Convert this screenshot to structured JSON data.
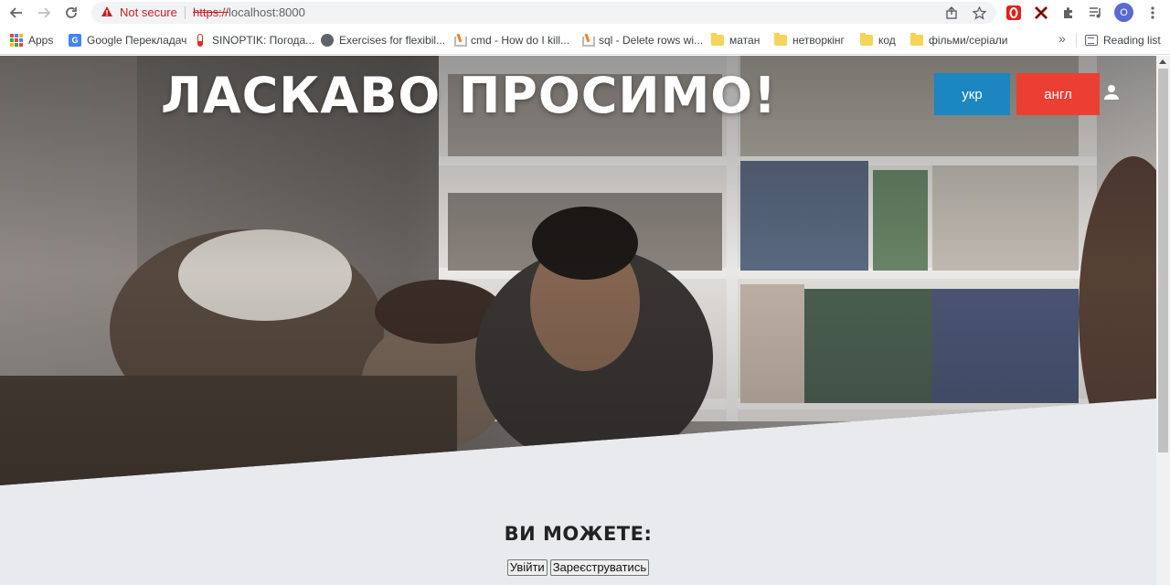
{
  "browser": {
    "security_label": "Not secure",
    "url_scheme": "https://",
    "url_host": "localhost:8000",
    "profile_initial": "O"
  },
  "bookmarks": {
    "items": [
      {
        "label": "Apps",
        "icon": "apps-grid-icon"
      },
      {
        "label": "Google Перекладач",
        "icon": "google-translate-icon"
      },
      {
        "label": "SINOPTIK: Погода...",
        "icon": "thermometer-icon"
      },
      {
        "label": "Exercises for flexibil...",
        "icon": "globe-icon"
      },
      {
        "label": "cmd - How do I kill...",
        "icon": "stackoverflow-icon"
      },
      {
        "label": "sql - Delete rows wi...",
        "icon": "stackoverflow-icon"
      },
      {
        "label": "матан",
        "icon": "folder-icon"
      },
      {
        "label": "нетворкінг",
        "icon": "folder-icon"
      },
      {
        "label": "код",
        "icon": "folder-icon"
      },
      {
        "label": "фільми/серіали",
        "icon": "folder-icon"
      }
    ],
    "more_label": "»",
    "reading_list": "Reading list"
  },
  "hero": {
    "title": "ЛАСКАВО ПРОСИМО!",
    "lang_ukr": "укр",
    "lang_eng": "англ"
  },
  "main": {
    "heading": "ВИ МОЖЕТЕ:",
    "login_label": "Увійти",
    "register_label": "Зареєструватись"
  },
  "colors": {
    "ukr_button": "#1b86c0",
    "eng_button": "#ec3f33",
    "page_background": "#e9eaee"
  }
}
